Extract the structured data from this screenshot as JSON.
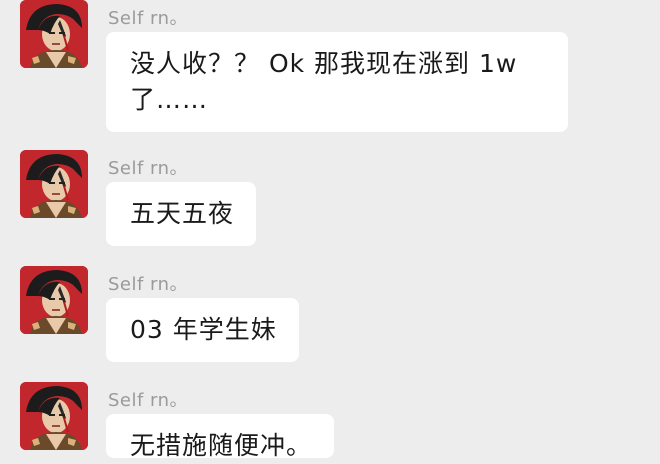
{
  "messages": [
    {
      "sender": "Self rn。",
      "text": "没人收？？ Ok 那我现在涨到 1w 了……",
      "avatar_icon": "anime-character-avatar-icon"
    },
    {
      "sender": "Self rn。",
      "text": "五天五夜",
      "avatar_icon": "anime-character-avatar-icon"
    },
    {
      "sender": "Self rn。",
      "text": "03 年学生妹",
      "avatar_icon": "anime-character-avatar-icon"
    },
    {
      "sender": "Self rn。",
      "text": "无措施随便冲。",
      "avatar_icon": "anime-character-avatar-icon"
    }
  ],
  "colors": {
    "background": "#ededed",
    "bubble": "#ffffff",
    "sender_text": "#9a9a9a",
    "message_text": "#1a1a1a",
    "avatar_red": "#c1272d"
  }
}
